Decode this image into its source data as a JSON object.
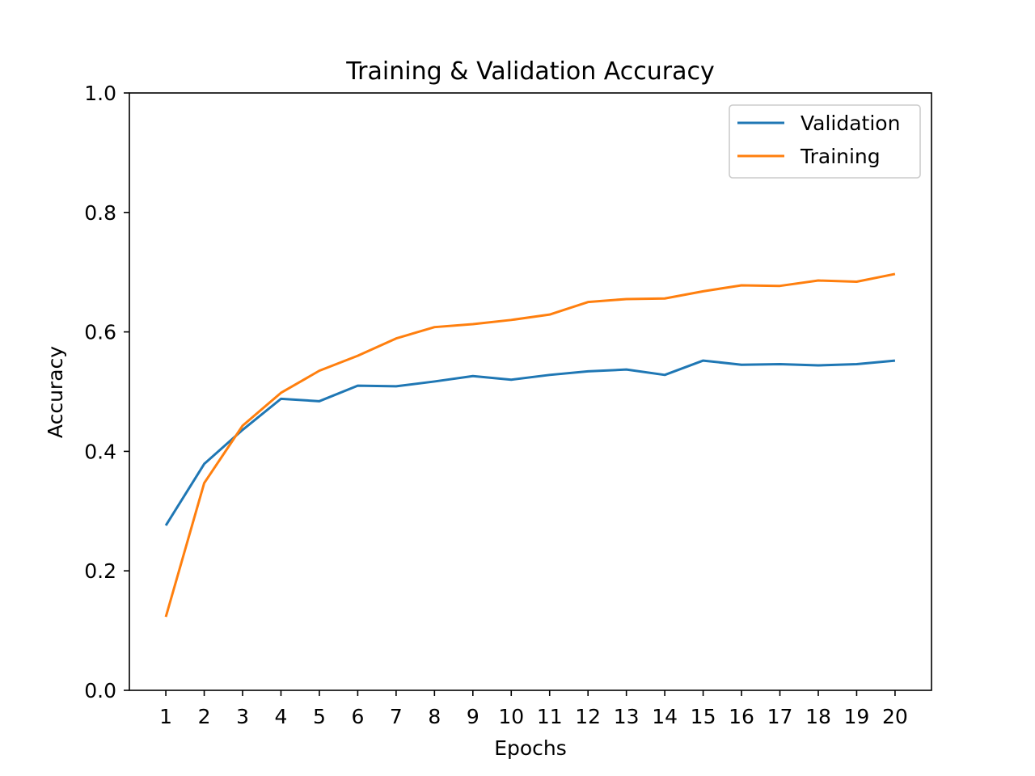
{
  "chart_data": {
    "type": "line",
    "title": "Training & Validation Accuracy",
    "xlabel": "Epochs",
    "ylabel": "Accuracy",
    "x": [
      1,
      2,
      3,
      4,
      5,
      6,
      7,
      8,
      9,
      10,
      11,
      12,
      13,
      14,
      15,
      16,
      17,
      18,
      19,
      20
    ],
    "xticks": [
      "1",
      "2",
      "3",
      "4",
      "5",
      "6",
      "7",
      "8",
      "9",
      "10",
      "11",
      "12",
      "13",
      "14",
      "15",
      "16",
      "17",
      "18",
      "19",
      "20"
    ],
    "yticks": [
      "0.0",
      "0.2",
      "0.4",
      "0.6",
      "0.8",
      "1.0"
    ],
    "ytick_values": [
      0.0,
      0.2,
      0.4,
      0.6,
      0.8,
      1.0
    ],
    "ylim": [
      0.0,
      1.0
    ],
    "xlim": [
      0.05,
      20.95
    ],
    "grid": false,
    "legend_position": "top-right",
    "series": [
      {
        "name": "Validation",
        "color": "#1f77b4",
        "values": [
          0.276,
          0.379,
          0.436,
          0.488,
          0.484,
          0.51,
          0.509,
          0.517,
          0.526,
          0.52,
          0.528,
          0.534,
          0.537,
          0.528,
          0.552,
          0.545,
          0.546,
          0.544,
          0.546,
          0.552
        ]
      },
      {
        "name": "Training",
        "color": "#ff7f0e",
        "values": [
          0.123,
          0.347,
          0.443,
          0.498,
          0.535,
          0.56,
          0.589,
          0.608,
          0.613,
          0.62,
          0.629,
          0.65,
          0.655,
          0.656,
          0.668,
          0.678,
          0.677,
          0.686,
          0.684,
          0.697
        ]
      }
    ]
  }
}
